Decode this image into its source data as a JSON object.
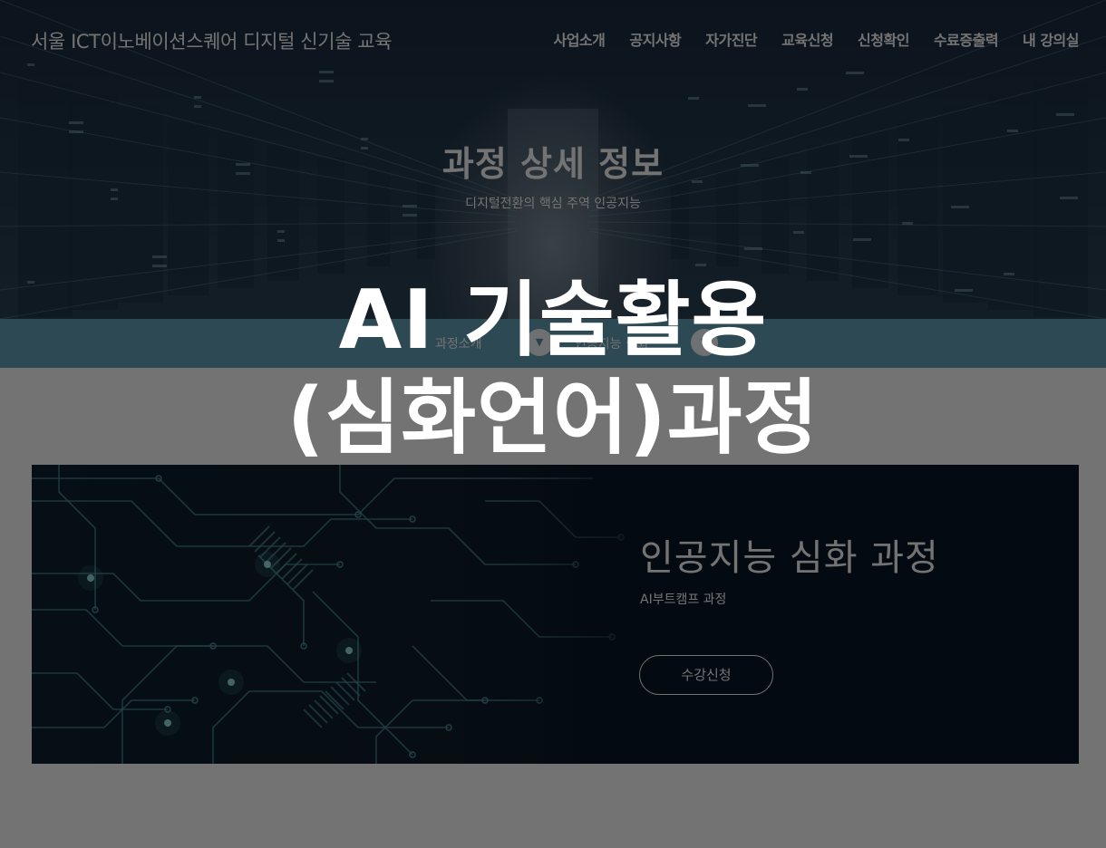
{
  "header": {
    "site_title": "서울 ICT이노베이션스퀘어 디지털 신기술 교육",
    "menu": [
      {
        "label": "사업소개"
      },
      {
        "label": "공지사항"
      },
      {
        "label": "자가진단"
      },
      {
        "label": "교육신청"
      },
      {
        "label": "신청확인"
      },
      {
        "label": "수료증출력"
      },
      {
        "label": "내 강의실"
      }
    ]
  },
  "hero": {
    "heading": "과정 상세 정보",
    "subheading": "디지털전환의 핵심 주역 인공지능"
  },
  "breadcrumb": {
    "items": [
      "과정소개",
      "인공지능 심화"
    ],
    "separator_icon": "chevron-down-icon"
  },
  "course": {
    "title": "인공지능 심화 과정",
    "subtitle": "AI부트캠프 과정",
    "apply_label": "수강신청"
  },
  "overlay": {
    "line1": "AI 기술활용",
    "line2": "(심화언어)과정"
  },
  "colors": {
    "breadcrumb_bar": "#62a2bb",
    "banner_bg": "#0e1d2c",
    "circuit_line": "#4e8e9a",
    "dim_overlay": "rgba(0,0,0,0.55)"
  }
}
